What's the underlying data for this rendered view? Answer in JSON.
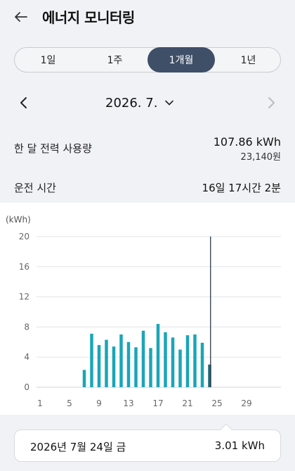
{
  "header": {
    "title": "에너지 모니터링",
    "back_icon": "arrow-left-icon"
  },
  "period_tabs": [
    {
      "label": "1일",
      "active": false
    },
    {
      "label": "1주",
      "active": false
    },
    {
      "label": "1개월",
      "active": true
    },
    {
      "label": "1년",
      "active": false
    }
  ],
  "date_nav": {
    "current": "2026. 7.",
    "prev_icon": "chevron-left-icon",
    "next_icon": "chevron-right-icon",
    "dropdown_icon": "chevron-down-icon"
  },
  "summary": {
    "usage_label": "한 달 전력 사용량",
    "usage_value": "107.86 kWh",
    "usage_cost": "23,140원",
    "runtime_label": "운전 시간",
    "runtime_value": "16일 17시간 2분"
  },
  "chart_data": {
    "type": "bar",
    "ylabel": "(kWh)",
    "ylim": [
      0,
      20
    ],
    "yticks": [
      0,
      4,
      8,
      12,
      16,
      20
    ],
    "xticks": [
      1,
      5,
      9,
      13,
      17,
      21,
      25,
      29
    ],
    "x": [
      7,
      8,
      9,
      10,
      11,
      12,
      13,
      14,
      15,
      16,
      17,
      18,
      19,
      20,
      21,
      22,
      23,
      24
    ],
    "values": [
      2.3,
      7.1,
      5.6,
      6.3,
      5.4,
      7.0,
      6.0,
      5.3,
      7.5,
      5.2,
      8.4,
      7.3,
      6.6,
      5.0,
      6.9,
      7.0,
      5.9,
      3.01
    ],
    "selected_day": 24,
    "grid": true,
    "bar_color": "#1aa5b8",
    "selected_color": "#1d6b7a",
    "marker_color": "#2b3a4d"
  },
  "tooltip": {
    "date": "2026년 7월 24일 금",
    "value": "3.01 kWh"
  }
}
